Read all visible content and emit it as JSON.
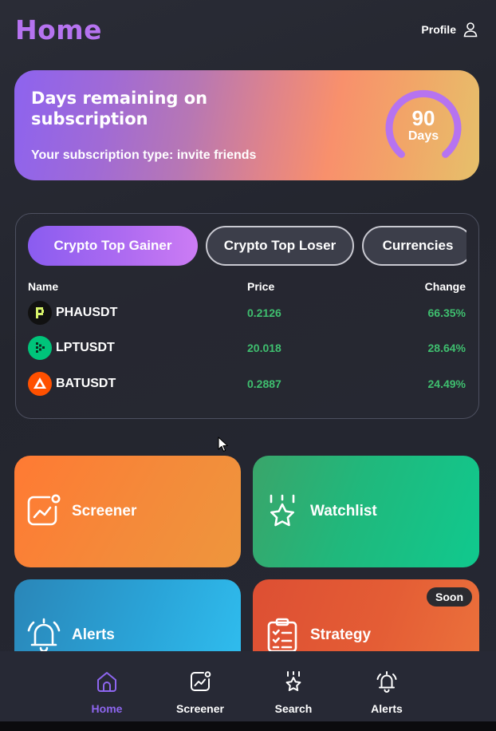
{
  "header": {
    "title": "Home",
    "profile_label": "Profile",
    "profile_icon": "user-icon"
  },
  "subscription": {
    "title": "Days remaining on subscription",
    "type_text": "Your subscription type: invite friends",
    "days_value": "90",
    "days_unit": "Days",
    "ring_color": "#b673f0"
  },
  "market": {
    "tabs": [
      {
        "label": "Crypto Top Gainer",
        "active": true
      },
      {
        "label": "Crypto Top Loser",
        "active": false
      },
      {
        "label": "Currencies",
        "active": false
      }
    ],
    "columns": {
      "name": "Name",
      "price": "Price",
      "change": "Change"
    },
    "rows": [
      {
        "symbol": "PHAUSDT",
        "price": "0.2126",
        "change": "66.35%",
        "icon": "pha-coin-icon",
        "icon_color": "#111111"
      },
      {
        "symbol": "LPTUSDT",
        "price": "20.018",
        "change": "28.64%",
        "icon": "lpt-coin-icon",
        "icon_color": "#00c47a"
      },
      {
        "symbol": "BATUSDT",
        "price": "0.2887",
        "change": "24.49%",
        "icon": "bat-coin-icon",
        "icon_color": "#ff5000"
      }
    ],
    "positive_color": "#3fbf6f"
  },
  "tiles": {
    "screener": {
      "label": "Screener",
      "icon": "chart-screen-icon"
    },
    "watchlist": {
      "label": "Watchlist",
      "icon": "star-icon"
    },
    "alerts": {
      "label": "Alerts",
      "icon": "bell-icon"
    },
    "strategy": {
      "label": "Strategy",
      "icon": "clipboard-list-icon",
      "badge": "Soon"
    }
  },
  "bottom_nav": {
    "items": [
      {
        "label": "Home",
        "icon": "home-icon",
        "active": true
      },
      {
        "label": "Screener",
        "icon": "chart-screen-icon",
        "active": false
      },
      {
        "label": "Search",
        "icon": "star-search-icon",
        "active": false
      },
      {
        "label": "Alerts",
        "icon": "bell-icon",
        "active": false
      }
    ],
    "active_color": "#8e66f0"
  }
}
